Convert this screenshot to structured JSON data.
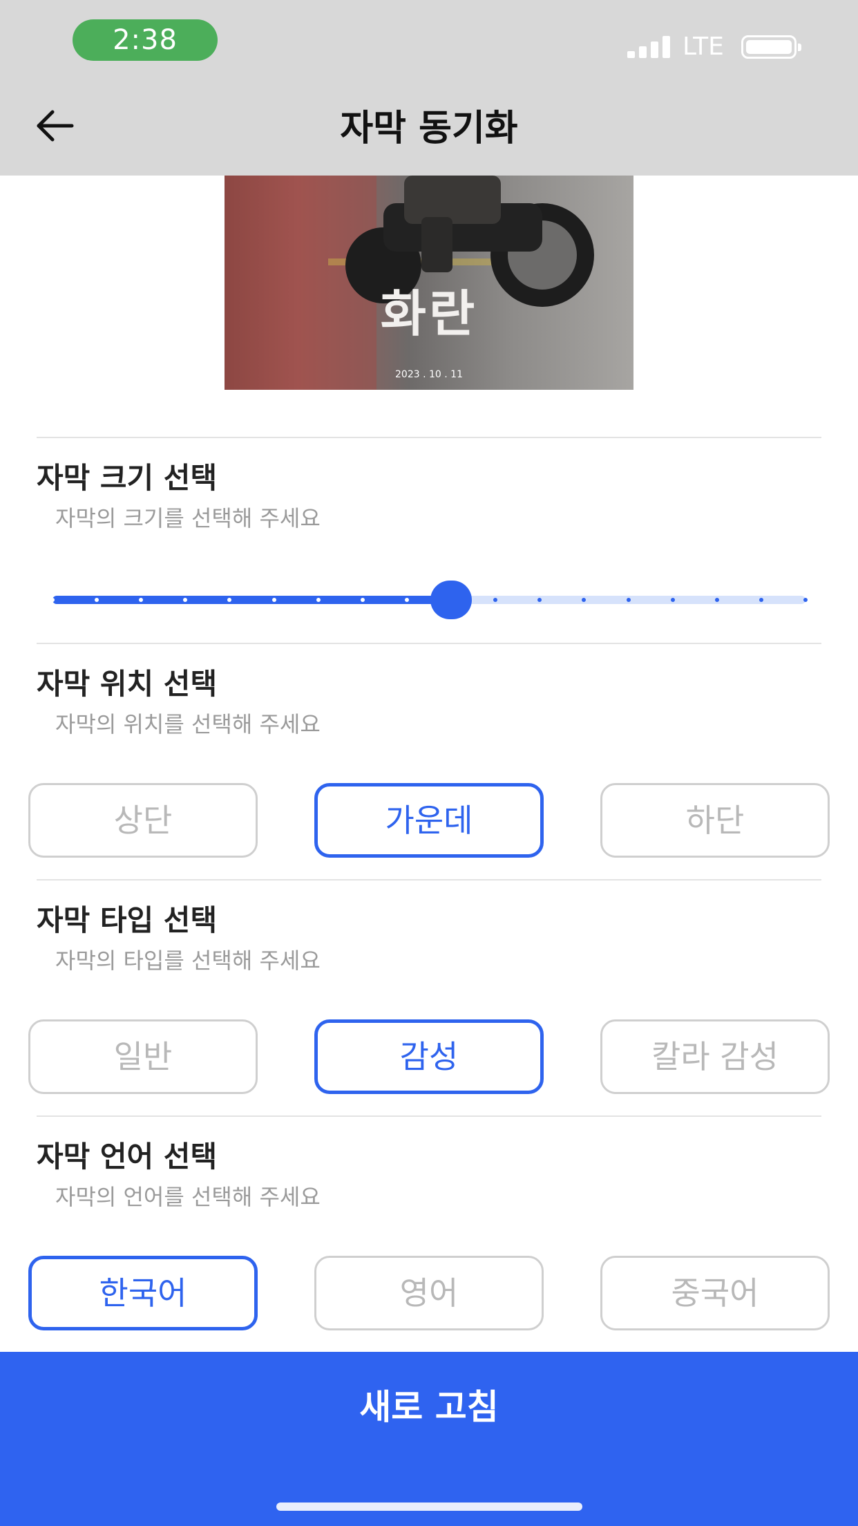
{
  "status_bar": {
    "time": "2:38",
    "network": "LTE"
  },
  "header": {
    "title": "자막 동기화"
  },
  "poster": {
    "title": "화란",
    "date": "2023 . 10 . 11"
  },
  "size_section": {
    "title": "자막 크기 선택",
    "subtitle": "자막의 크기를 선택해 주세요"
  },
  "size_slider": {
    "steps": 18,
    "selected_index": 9
  },
  "position_section": {
    "title": "자막 위치 선택",
    "subtitle": "자막의 위치를 선택해 주세요",
    "options": [
      "상단",
      "가운데",
      "하단"
    ],
    "selected": "가운데"
  },
  "type_section": {
    "title": "자막 타입 선택",
    "subtitle": "자막의 타입를 선택해 주세요",
    "options": [
      "일반",
      "감성",
      "칼라 감성"
    ],
    "selected": "감성"
  },
  "language_section": {
    "title": "자막 언어 선택",
    "subtitle": "자막의 언어를 선택해 주세요",
    "options": [
      "한국어",
      "영어",
      "중국어"
    ],
    "selected": "한국어"
  },
  "refresh_button": {
    "label": "새로 고침"
  },
  "colors": {
    "accent": "#2e63ee",
    "header_bg": "#d8d8d8",
    "time_pill": "#4cae5a"
  }
}
